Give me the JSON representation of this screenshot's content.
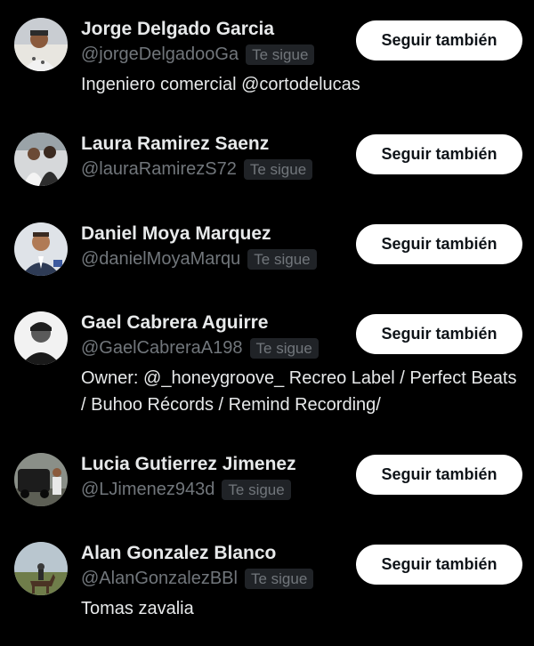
{
  "users": [
    {
      "name": "Jorge Delgado Garcia",
      "handle": "@jorgeDelgadooGa",
      "badge": "Te sigue",
      "button": "Seguir también",
      "bio": "Ingeniero comercial @cortodelucas",
      "avatar_icon": "avatar-man-selfie"
    },
    {
      "name": "Laura Ramirez Saenz",
      "handle": "@lauraRamirezS72",
      "badge": "Te sigue",
      "button": "Seguir también",
      "bio": "",
      "avatar_icon": "avatar-couple-photo"
    },
    {
      "name": "Daniel Moya Marquez",
      "handle": "@danielMoyaMarqu",
      "badge": "Te sigue",
      "button": "Seguir también",
      "bio": "",
      "avatar_icon": "avatar-man-suit"
    },
    {
      "name": "Gael Cabrera Aguirre",
      "handle": "@GaelCabreraA198",
      "badge": "Te sigue",
      "button": "Seguir también",
      "bio": "Owner: @_honeygroove_ Recreo Label / Perfect Beats / Buhoo Récords / Remind Recording/",
      "avatar_icon": "avatar-man-bw"
    },
    {
      "name": "Lucia Gutierrez Jimenez",
      "handle": "@LJimenez943d",
      "badge": "Te sigue",
      "button": "Seguir también",
      "bio": "",
      "avatar_icon": "avatar-person-car"
    },
    {
      "name": "Alan Gonzalez Blanco",
      "handle": "@AlanGonzalezBBl",
      "badge": "Te sigue",
      "button": "Seguir también",
      "bio": "Tomas zavalia",
      "avatar_icon": "avatar-horse-rider"
    }
  ],
  "colors": {
    "background": "#000000",
    "name": "#e7e9ea",
    "handle": "#71767b",
    "badge_bg": "#202327",
    "button_bg": "#ffffff",
    "button_text": "#0f1419"
  }
}
